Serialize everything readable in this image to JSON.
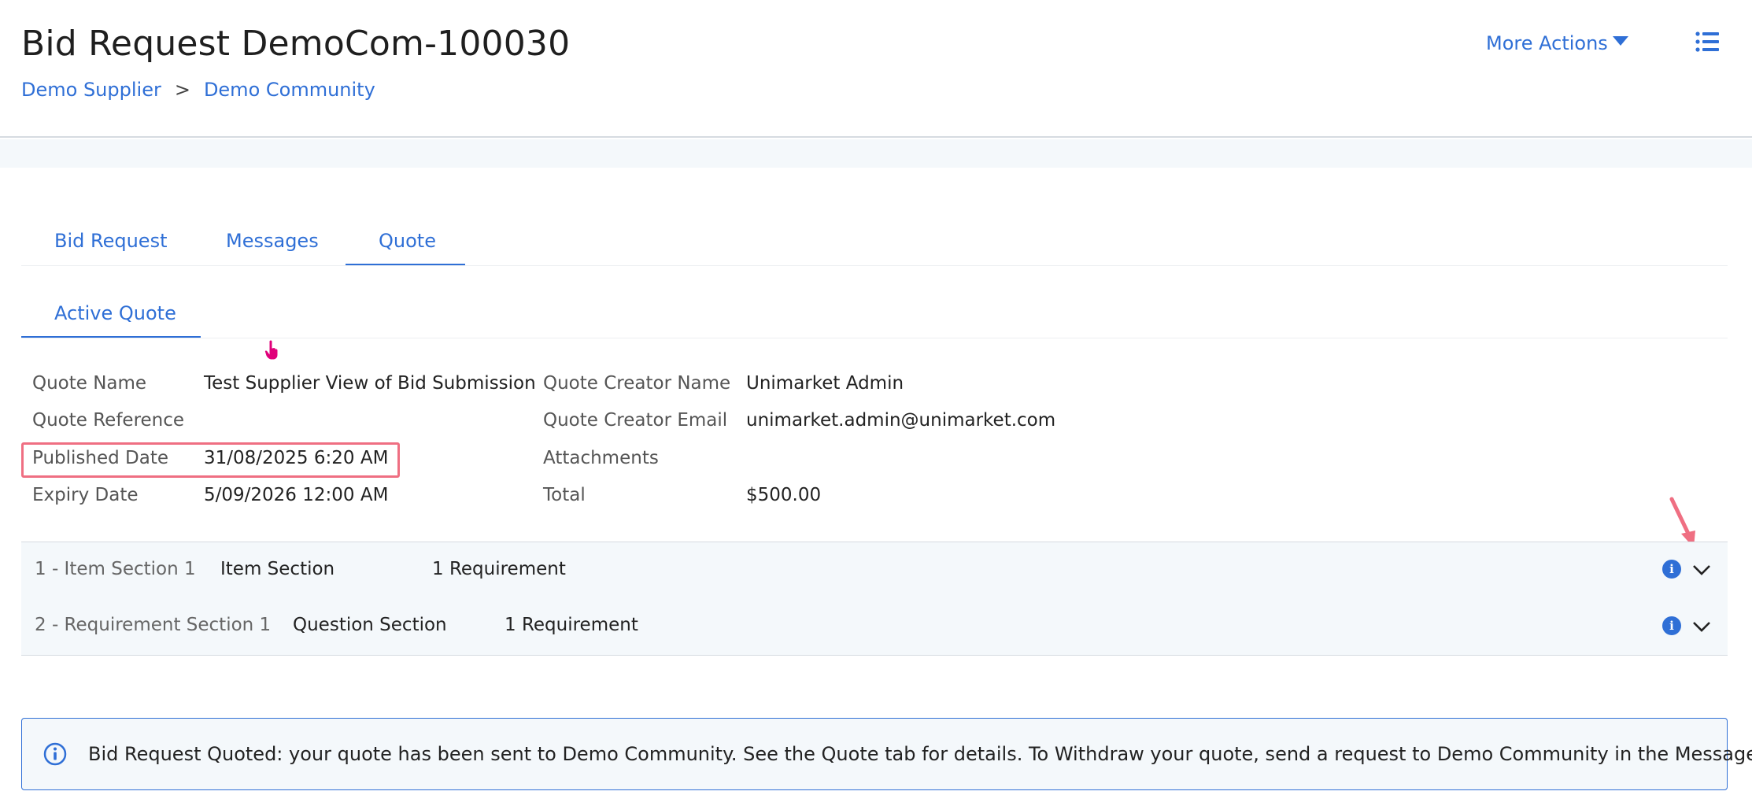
{
  "header": {
    "title": "Bid Request DemoCom-100030",
    "breadcrumb": [
      "Demo Supplier",
      "Demo Community"
    ],
    "breadcrumb_sep": ">",
    "more_actions_label": "More Actions"
  },
  "tabs": [
    {
      "label": "Bid Request",
      "active": false
    },
    {
      "label": "Messages",
      "active": false
    },
    {
      "label": "Quote",
      "active": true
    }
  ],
  "subtabs": [
    {
      "label": "Active Quote",
      "active": true
    }
  ],
  "quote": {
    "left": [
      {
        "label": "Quote Name",
        "value": "Test Supplier View of Bid Submission"
      },
      {
        "label": "Quote Reference",
        "value": ""
      },
      {
        "label": "Published Date",
        "value": "31/08/2025 6:20 AM"
      },
      {
        "label": "Expiry Date",
        "value": "5/09/2026 12:00 AM"
      }
    ],
    "right": [
      {
        "label": "Quote Creator Name",
        "value": "Unimarket Admin"
      },
      {
        "label": "Quote Creator Email",
        "value": "unimarket.admin@unimarket.com"
      },
      {
        "label": "Attachments",
        "value": ""
      },
      {
        "label": "Total",
        "value": "$500.00"
      }
    ]
  },
  "sections": [
    {
      "number": "1 - Item Section 1",
      "type": "Item Section",
      "requirements": "1 Requirement"
    },
    {
      "number": "2 - Requirement Section 1",
      "type": "Question Section",
      "requirements": "1 Requirement"
    }
  ],
  "alert": {
    "text": "Bid Request Quoted: your quote has been sent to Demo Community. See the Quote tab for details. To Withdraw your quote, send a request to Demo Community in the Messages tab."
  },
  "colors": {
    "accent": "#2f6fd6",
    "highlight": "#ef6f82",
    "band": "#f4f8fb"
  }
}
